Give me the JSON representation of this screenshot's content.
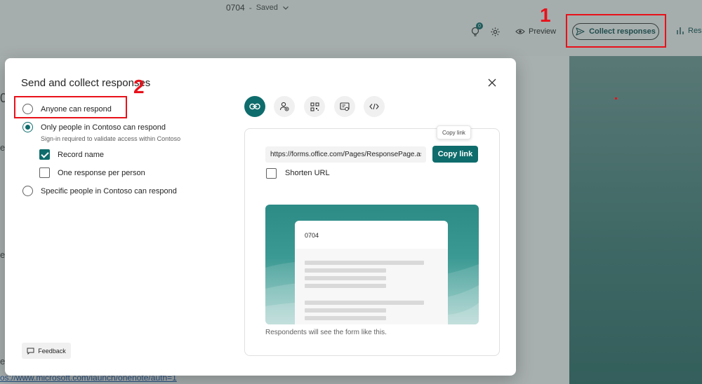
{
  "topbar": {
    "form_name": "0704",
    "separator": "-",
    "save_status": "Saved",
    "badge_count": "0",
    "preview_label": "Preview",
    "collect_label": "Collect responses",
    "responses_label": "Resp"
  },
  "background": {
    "left_chars": [
      "0",
      "e",
      "e",
      "e"
    ],
    "link_fragment": "os://www.microsoft.com/launch/onenote/auth=1"
  },
  "annotations": {
    "num1": "1",
    "num2": "2"
  },
  "dialog": {
    "title": "Send and collect responses",
    "options": {
      "anyone": "Anyone can respond",
      "org": "Only people in Contoso can respond",
      "org_sub": "Sign-in required to validate access within Contoso",
      "record_name": "Record name",
      "one_response": "One response per person",
      "specific": "Specific people in Contoso can respond"
    },
    "feedback_label": "Feedback",
    "share": {
      "tooltip": "Copy link",
      "url": "https://forms.office.com/Pages/ResponsePage.aspx",
      "copy_label": "Copy link",
      "shorten_label": "Shorten URL",
      "preview_title": "0704",
      "caption": "Respondents will see the form like this."
    }
  },
  "colors": {
    "accent": "#0f6c6c",
    "annotation": "#e8111a"
  }
}
